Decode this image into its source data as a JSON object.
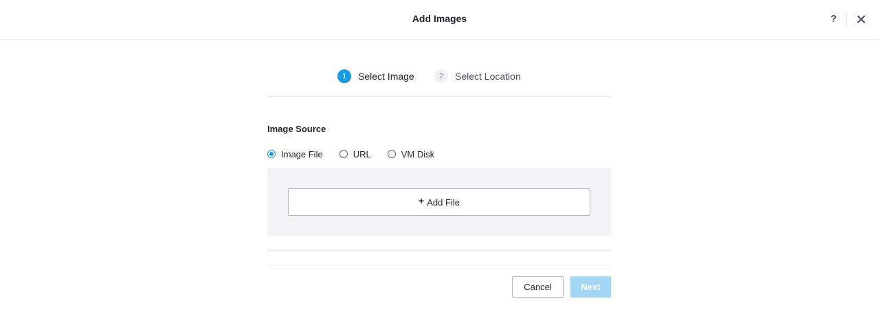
{
  "dialog": {
    "title": "Add Images",
    "help_label": "?",
    "close_icon": "close-icon"
  },
  "steps": [
    {
      "number": "1",
      "label": "Select Image",
      "active": true
    },
    {
      "number": "2",
      "label": "Select Location",
      "active": false
    }
  ],
  "image_source": {
    "label": "Image Source",
    "options": [
      {
        "label": "Image File",
        "selected": true
      },
      {
        "label": "URL",
        "selected": false
      },
      {
        "label": "VM Disk",
        "selected": false
      }
    ]
  },
  "upload": {
    "add_file_icon": "plus-icon",
    "add_file_plus": "+",
    "add_file_label": "Add File"
  },
  "footer": {
    "cancel_label": "Cancel",
    "next_label": "Next",
    "next_disabled": true
  },
  "colors": {
    "accent": "#1b9ae4",
    "accent_disabled": "#a3d6f5",
    "panel_bg": "#f2f3f5"
  }
}
